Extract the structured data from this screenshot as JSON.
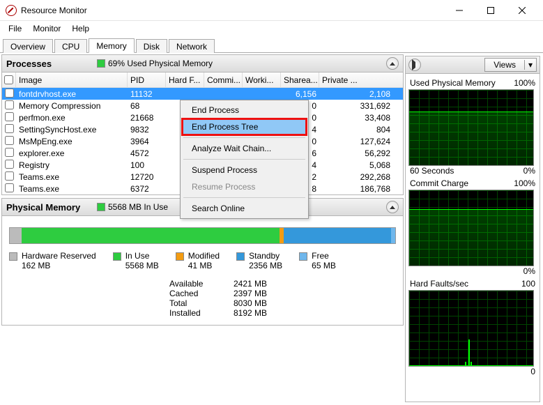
{
  "window": {
    "title": "Resource Monitor"
  },
  "menu": {
    "file": "File",
    "monitor": "Monitor",
    "help": "Help"
  },
  "tabs": {
    "overview": "Overview",
    "cpu": "CPU",
    "memory": "Memory",
    "disk": "Disk",
    "network": "Network"
  },
  "processes_panel": {
    "title": "Processes",
    "stat": "69% Used Physical Memory",
    "swatch_color": "#2ecc40",
    "columns": {
      "image": "Image",
      "pid": "PID",
      "hardf": "Hard F...",
      "commit": "Commi...",
      "working": "Worki...",
      "sharea": "Sharea...",
      "private": "Private ..."
    },
    "rows": [
      {
        "image": "fontdrvhost.exe",
        "pid": "11132",
        "sharea": "6,156",
        "private": "2,108",
        "selected": true
      },
      {
        "image": "Memory Compression",
        "pid": "68",
        "sharea": "0",
        "private": "331,692"
      },
      {
        "image": "perfmon.exe",
        "pid": "21668",
        "sharea": "0",
        "private": "33,408"
      },
      {
        "image": "SettingSyncHost.exe",
        "pid": "9832",
        "sharea": "4",
        "private": "804"
      },
      {
        "image": "MsMpEng.exe",
        "pid": "3964",
        "sharea": "0",
        "private": "127,624"
      },
      {
        "image": "explorer.exe",
        "pid": "4572",
        "sharea": "6",
        "private": "56,292"
      },
      {
        "image": "Registry",
        "pid": "100",
        "sharea": "4",
        "private": "5,068"
      },
      {
        "image": "Teams.exe",
        "pid": "12720",
        "sharea": "2",
        "private": "292,268"
      },
      {
        "image": "Teams.exe",
        "pid": "6372",
        "sharea": "8",
        "private": "186,768"
      }
    ]
  },
  "context_menu": {
    "end_process": "End Process",
    "end_process_tree": "End Process Tree",
    "analyze": "Analyze Wait Chain...",
    "suspend": "Suspend Process",
    "resume": "Resume Process",
    "search": "Search Online"
  },
  "physical_panel": {
    "title": "Physical Memory",
    "inuse": "5568 MB In Use",
    "available": "2421 MB Available",
    "inuse_color": "#2ecc40",
    "avail_color": "#2b6cb0",
    "bar": [
      {
        "color": "#bbbbbb",
        "w": 3
      },
      {
        "color": "#2ecc40",
        "w": 67
      },
      {
        "color": "#f39c12",
        "w": 1
      },
      {
        "color": "#3498db",
        "w": 28
      },
      {
        "color": "#6fb7ec",
        "w": 1
      }
    ],
    "legend": {
      "hardware": {
        "label": "Hardware Reserved",
        "value": "162 MB",
        "color": "#bbbbbb"
      },
      "inuse": {
        "label": "In Use",
        "value": "5568 MB",
        "color": "#2ecc40"
      },
      "modified": {
        "label": "Modified",
        "value": "41 MB",
        "color": "#f39c12"
      },
      "standby": {
        "label": "Standby",
        "value": "2356 MB",
        "color": "#3498db"
      },
      "free": {
        "label": "Free",
        "value": "65 MB",
        "color": "#6fb7ec"
      }
    },
    "totals": {
      "available": {
        "k": "Available",
        "v": "2421 MB"
      },
      "cached": {
        "k": "Cached",
        "v": "2397 MB"
      },
      "total": {
        "k": "Total",
        "v": "8030 MB"
      },
      "installed": {
        "k": "Installed",
        "v": "8192 MB"
      }
    }
  },
  "right": {
    "views": "Views",
    "charts": [
      {
        "title": "Used Physical Memory",
        "rval": "100%",
        "bot_l": "60 Seconds",
        "bot_r": "0%",
        "fill_top": 31
      },
      {
        "title": "Commit Charge",
        "rval": "100%",
        "bot_l": "",
        "bot_r": "0%",
        "fill_top": 27
      },
      {
        "title": "Hard Faults/sec",
        "rval": "100",
        "bot_l": "",
        "bot_r": "0",
        "spike": true
      }
    ]
  },
  "chart_data": [
    {
      "type": "area",
      "title": "Used Physical Memory",
      "xlabel": "60 Seconds",
      "ylabel": "%",
      "ylim": [
        0,
        100
      ],
      "series": [
        {
          "name": "used",
          "values": [
            69,
            69,
            69,
            69,
            69,
            69,
            69,
            69,
            69,
            69,
            69,
            69
          ]
        }
      ]
    },
    {
      "type": "area",
      "title": "Commit Charge",
      "xlabel": "",
      "ylabel": "%",
      "ylim": [
        0,
        100
      ],
      "series": [
        {
          "name": "commit",
          "values": [
            73,
            73,
            73,
            73,
            73,
            73,
            73,
            73,
            73,
            73,
            73,
            73
          ]
        }
      ]
    },
    {
      "type": "line",
      "title": "Hard Faults/sec",
      "xlabel": "",
      "ylabel": "faults/sec",
      "ylim": [
        0,
        100
      ],
      "series": [
        {
          "name": "faults",
          "values": [
            0,
            0,
            0,
            1,
            0,
            0,
            0,
            35,
            3,
            0,
            0,
            0
          ]
        }
      ]
    }
  ]
}
